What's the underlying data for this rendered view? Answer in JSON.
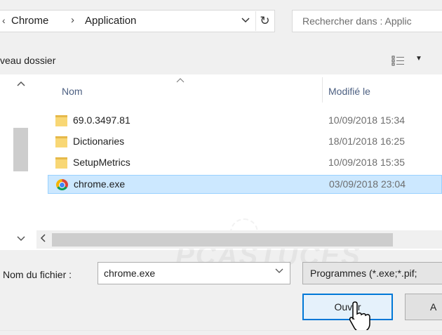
{
  "address_bar": {
    "lead_chevron": "‹",
    "crumbs": [
      "Chrome",
      "Application"
    ],
    "separator": "›",
    "dropdown_glyph": "⌄",
    "refresh_glyph": "↻"
  },
  "search": {
    "placeholder": "Rechercher dans : Applic"
  },
  "toolbar": {
    "new_folder_label": "veau dossier",
    "view_dropdown_glyph": "▼"
  },
  "columns": {
    "name": "Nom",
    "modified": "Modifié le"
  },
  "files": [
    {
      "name": "69.0.3497.81",
      "modified": "10/09/2018 15:34",
      "icon": "folder-icon",
      "selected": false
    },
    {
      "name": "Dictionaries",
      "modified": "18/01/2018 16:25",
      "icon": "folder-icon",
      "selected": false
    },
    {
      "name": "SetupMetrics",
      "modified": "10/09/2018 15:35",
      "icon": "folder-icon",
      "selected": false
    },
    {
      "name": "chrome.exe",
      "modified": "03/09/2018 23:04",
      "icon": "chrome-icon",
      "selected": true
    }
  ],
  "watermark": "PCASTUCES",
  "filename": {
    "label": "Nom du fichier :",
    "value": "chrome.exe"
  },
  "filter": {
    "selected": "Programmes (*.exe;*.pif;"
  },
  "buttons": {
    "open": "Ouvrir",
    "cancel": "A"
  },
  "colors": {
    "accent": "#0078d7",
    "selection": "#cce8ff",
    "selection_border": "#99d1ff",
    "folder": "#f8d775"
  }
}
